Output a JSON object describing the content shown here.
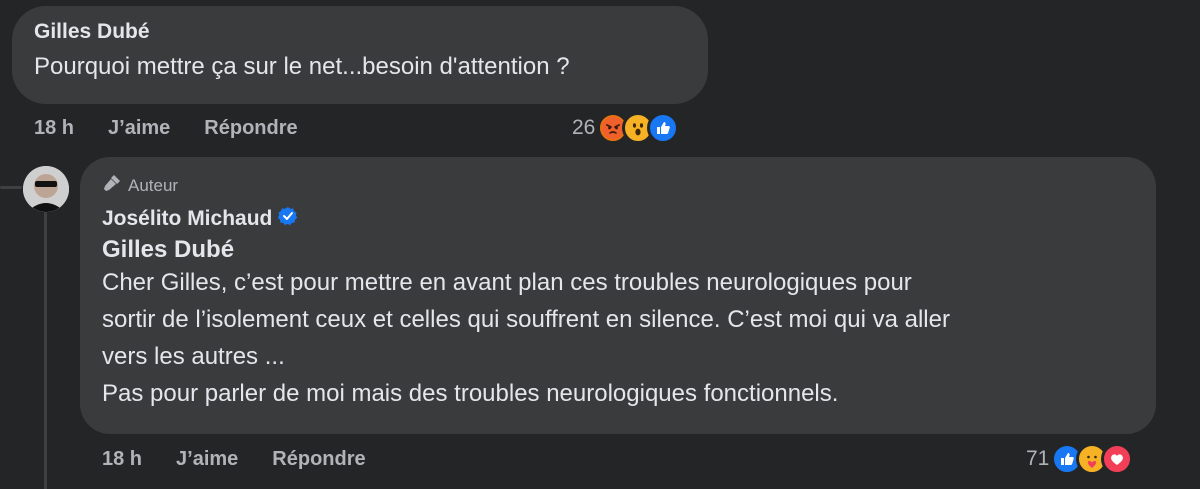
{
  "comment1": {
    "author": "Gilles Dubé",
    "text": "Pourquoi mettre ça sur le net...besoin d'attention ?",
    "time": "18 h",
    "like_label": "J’aime",
    "reply_label": "Répondre",
    "reaction_count": "26",
    "reactions": [
      "angry-icon",
      "wow-icon",
      "like-icon"
    ]
  },
  "comment2": {
    "badge": "Auteur",
    "author": "Josélito Michaud",
    "verified": true,
    "mention": "Gilles Dubé",
    "paragraphs": [
      "Cher Gilles, c’est pour mettre en avant plan ces troubles neurologiques pour",
      "sortir de l’isolement ceux et celles qui souffrent en silence. C’est moi qui va aller",
      "vers les autres ...",
      "Pas pour parler de moi mais des troubles neurologiques fonctionnels."
    ],
    "time": "18 h",
    "like_label": "J’aime",
    "reply_label": "Répondre",
    "reaction_count": "71",
    "reactions": [
      "like-icon",
      "care-icon",
      "love-icon"
    ]
  },
  "colors": {
    "background": "#242526",
    "bubble": "#3a3b3c",
    "like_blue": "#1877f2",
    "love_red": "#f33e58",
    "angry": "#e9710f",
    "wow_yellow": "#f7b125"
  }
}
